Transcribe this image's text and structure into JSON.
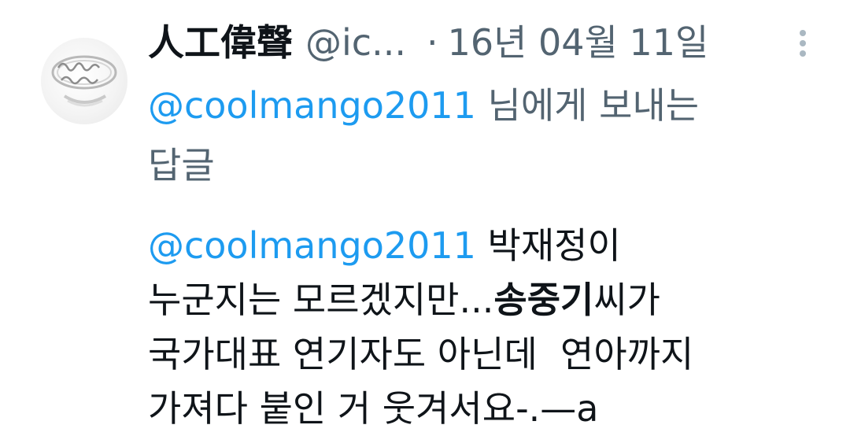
{
  "tweet": {
    "display_name": "人工偉聲",
    "handle": "@ic...",
    "separator": "·",
    "date": "16년 04월 11일",
    "reply_to_handle": "@coolmango2011",
    "reply_to_suffix_line1": " 님에게 보내는",
    "reply_to_suffix_line2": "답글",
    "body": {
      "mention": "@coolmango2011",
      "line1_after_mention": " 박재정이",
      "line2_part1": "누군지는 모르겠지만...",
      "line2_bold": "송중기",
      "line2_part2": "씨가",
      "line3": "국가대표 연기자도 아닌데  연아까지",
      "line4": "가져다 붙인 거 웃겨서요-.—a"
    },
    "avatar_icon": "ring-icon",
    "more_icon": "more-vertical-icon"
  }
}
